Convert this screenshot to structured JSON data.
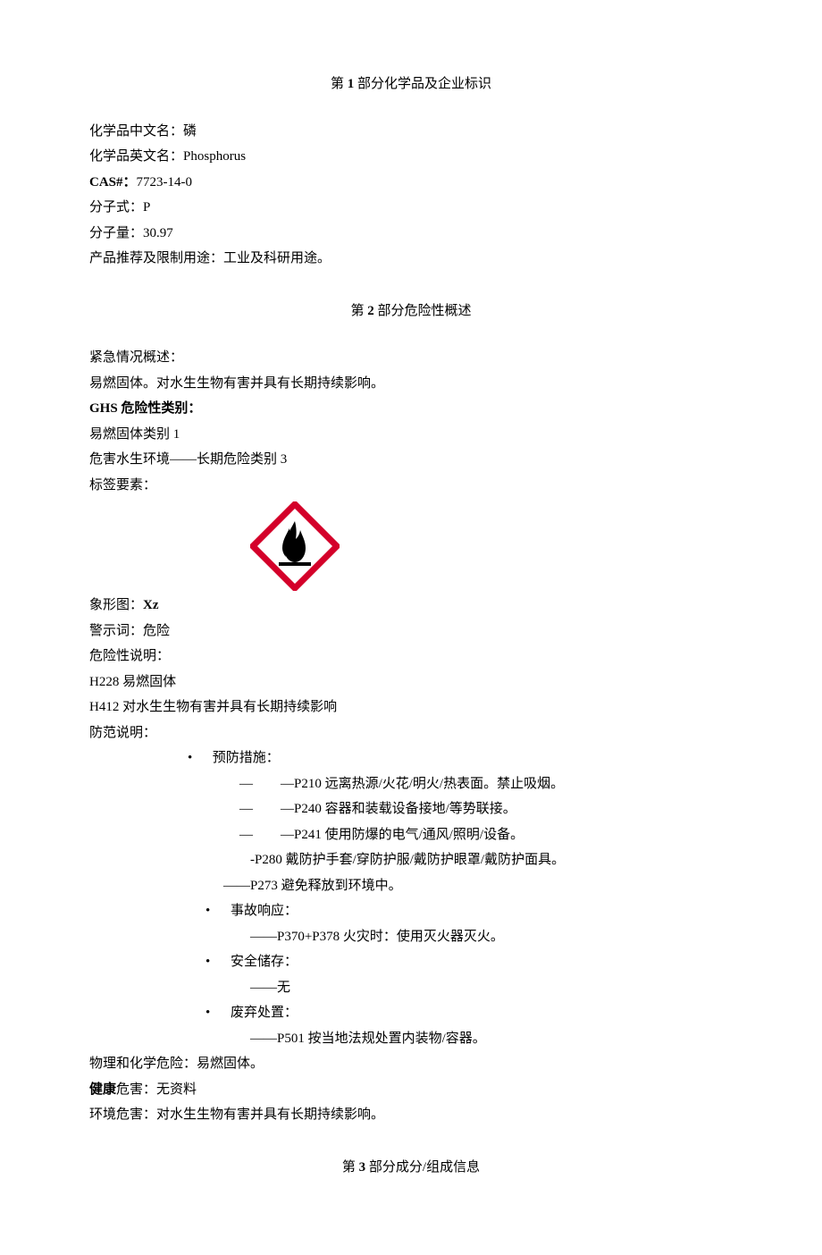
{
  "section1": {
    "heading_pre": "第 ",
    "heading_num": "1",
    "heading_post": " 部分化学品及企业标识",
    "cn_name_label": "化学品中文名：",
    "cn_name_value": "磷",
    "en_name_label": "化学品英文名：",
    "en_name_value": "Phosphorus",
    "cas_label": "CAS#：",
    "cas_value": "7723-14-0",
    "formula_label": "分子式：",
    "formula_value": "P",
    "mw_label": "分子量：",
    "mw_value": "30.97",
    "use_label": "产品推荐及限制用途：",
    "use_value": "工业及科研用途。"
  },
  "section2": {
    "heading_pre": "第 ",
    "heading_num": "2",
    "heading_post": " 部分危险性概述",
    "emergency_label": "紧急情况概述：",
    "emergency_text": "易燃固体。对水生生物有害并具有长期持续影响。",
    "ghs_label": "GHS 危险性类别：",
    "ghs_line1": "易燃固体类别 1",
    "ghs_line2": "危害水生环境——长期危险类别 3",
    "label_elements": "标签要素：",
    "pictogram_label": "象形图：",
    "pictogram_code": "Xz",
    "signal_label": "警示词：",
    "signal_value": "危险",
    "hazard_stmt_label": "危险性说明：",
    "h228": "H228 易燃固体",
    "h412": "H412 对水生生物有害并具有长期持续影响",
    "precaution_label": "防范说明：",
    "prevention_label": "预防措施：",
    "p210": "—P210 远离热源/火花/明火/热表面。禁止吸烟。",
    "p240": "—P240 容器和装载设备接地/等势联接。",
    "p241": "—P241 使用防爆的电气/通风/照明/设备。",
    "p280": "-P280 戴防护手套/穿防护服/戴防护眼罩/戴防护面具。",
    "p273": "——P273 避免释放到环境中。",
    "dash": "—",
    "response_label": "事故响应：",
    "p370": "——P370+P378 火灾时：使用灭火器灭火。",
    "storage_label": "安全储存：",
    "storage_val": "——无",
    "disposal_label": "废弃处置：",
    "p501": "——P501 按当地法规处置内装物/容器。",
    "phys_label": "物理和化学危险：",
    "phys_value": "易燃固体。",
    "health_label": "健康",
    "health_rest": "危害：无资料",
    "env_label": "环境危害：",
    "env_value": "对水生生物有害并具有长期持续影响。"
  },
  "section3": {
    "heading_pre": "第 ",
    "heading_num": "3",
    "heading_post": " 部分成分/组成信息"
  }
}
